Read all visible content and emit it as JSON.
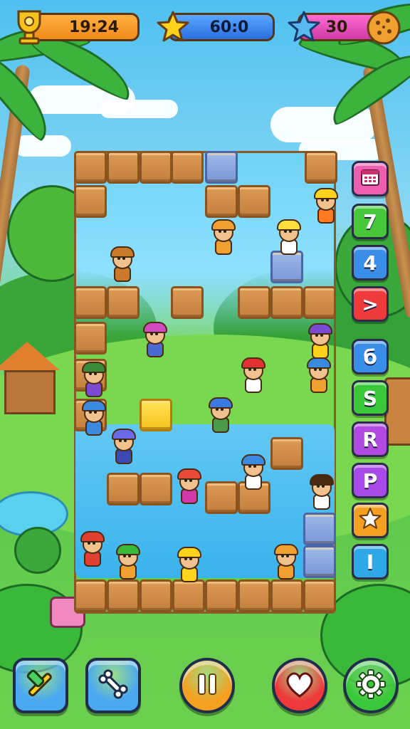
{
  "hud": {
    "timer": "19:24",
    "score": "60:0",
    "coins": "30",
    "timer_icon": "trophy-icon",
    "score_icon": "star-icon",
    "coins_icon": "star-icon",
    "extra_icon": "cookie-icon"
  },
  "side_buttons": [
    {
      "label": "",
      "icon": "calendar-icon",
      "color": "#ee5fb0"
    },
    {
      "label": "7",
      "icon": "",
      "color": "#46c83a"
    },
    {
      "label": "4",
      "icon": "",
      "color": "#3a8ee8"
    },
    {
      "label": ">",
      "icon": "",
      "color": "#ee3a3a"
    },
    {
      "label": "б",
      "icon": "",
      "color": "#3a8ee8"
    },
    {
      "label": "S",
      "icon": "",
      "color": "#3ac83a"
    },
    {
      "label": "R",
      "icon": "",
      "color": "#b04ae0"
    },
    {
      "label": "P",
      "icon": "",
      "color": "#a84ae8"
    },
    {
      "label": "",
      "icon": "star-icon",
      "color": "#f5a020"
    },
    {
      "label": "I",
      "icon": "",
      "color": "#2fa8e8"
    }
  ],
  "bottom_buttons": [
    {
      "icon": "hammer-tool-icon",
      "color": "#4aa8f0"
    },
    {
      "icon": "bone-icon",
      "color": "#4aa8f0"
    },
    {
      "icon": "pause-icon",
      "color": "#f5a020"
    },
    {
      "icon": "heart-icon",
      "color": "#ee3a3a"
    },
    {
      "icon": "gear-icon",
      "color": "#3ac83a"
    }
  ],
  "colors": {
    "sky": "#4fc0f0",
    "grass": "#6dd04f",
    "tile": "#d08a48",
    "tile_blue": "#8aa8e0",
    "water": "#4abcf0"
  }
}
